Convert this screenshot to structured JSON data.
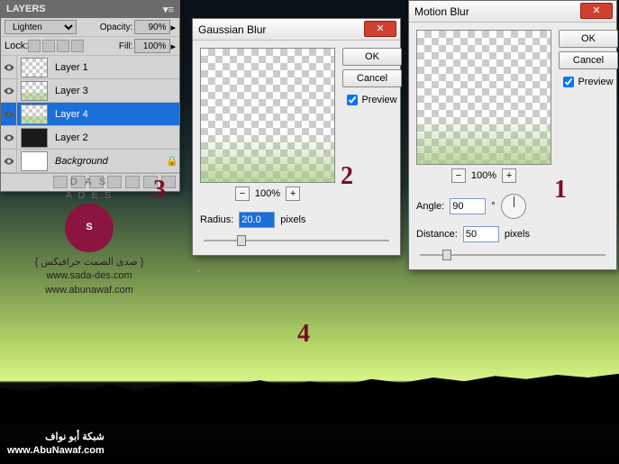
{
  "layers_panel": {
    "title": "LAYERS",
    "blend_mode": "Lighten",
    "opacity_label": "Opacity:",
    "opacity_value": "90%",
    "lock_label": "Lock:",
    "fill_label": "Fill:",
    "fill_value": "100%",
    "items": [
      {
        "name": "Layer 1",
        "thumb": "check"
      },
      {
        "name": "Layer 3",
        "thumb": "check-g"
      },
      {
        "name": "Layer 4",
        "thumb": "check-g",
        "selected": true
      },
      {
        "name": "Layer 2",
        "thumb": "dark"
      },
      {
        "name": "Background",
        "thumb": "white",
        "italic": true,
        "locked": true
      }
    ]
  },
  "gaussian": {
    "title": "Gaussian Blur",
    "ok": "OK",
    "cancel": "Cancel",
    "preview": "Preview",
    "zoom": "100%",
    "radius_label": "Radius:",
    "radius_value": "20.0",
    "radius_unit": "pixels"
  },
  "motion": {
    "title": "Motion Blur",
    "ok": "OK",
    "cancel": "Cancel",
    "preview": "Preview",
    "zoom": "100%",
    "angle_label": "Angle:",
    "angle_value": "90",
    "angle_unit": "°",
    "distance_label": "Distance:",
    "distance_value": "50",
    "distance_unit": "pixels"
  },
  "markers": {
    "m1": "1",
    "m2": "2",
    "m3": "3",
    "m4": "4"
  },
  "watermark": {
    "brand_top": "D A S",
    "brand_top2": "A D E S",
    "letter": "S",
    "arabic": "{ صدى الصمت جرافيكس }",
    "url1": "www.sada-des.com",
    "url2": "www.abunawaf.com"
  },
  "footer": {
    "arabic": "شبكة أبو نواف",
    "url": "www.AbuNawaf.com"
  }
}
